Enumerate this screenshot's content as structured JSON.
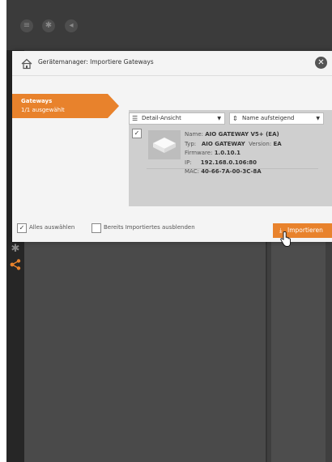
{
  "dialog": {
    "title": "Gerätemanager: Importiere Gateways",
    "tab": {
      "label": "Gateways",
      "sublabel": "1/1 ausgewählt"
    },
    "toolbar": {
      "view_select": "Detail-Ansicht",
      "sort_select": "Name aufsteigend"
    },
    "gateway": {
      "name_label": "Name:",
      "name": "AIO GATEWAY V5+ (EA)",
      "type_label": "Typ:",
      "type": "AIO GATEWAY",
      "version_label": "Version:",
      "version": "EA",
      "firmware_label": "Firmware:",
      "firmware": "1.0.10.1",
      "ip_label": "IP:",
      "ip": "192.168.0.106:80",
      "mac_label": "MAC:",
      "mac": "40-66-7A-00-3C-8A"
    },
    "footer": {
      "select_all": "Alles auswählen",
      "hide_imported": "Bereits Importiertes ausblenden",
      "import_button": "Importieren"
    }
  },
  "colors": {
    "accent": "#e8822c",
    "dark_bg": "#3f3f3f",
    "dialog_bg": "#f4f4f4"
  },
  "icons": [
    "menu-icon",
    "puzzle-icon",
    "back-icon",
    "home-icon",
    "close-icon",
    "list-icon",
    "sort-icon",
    "download-icon",
    "share-icon"
  ]
}
